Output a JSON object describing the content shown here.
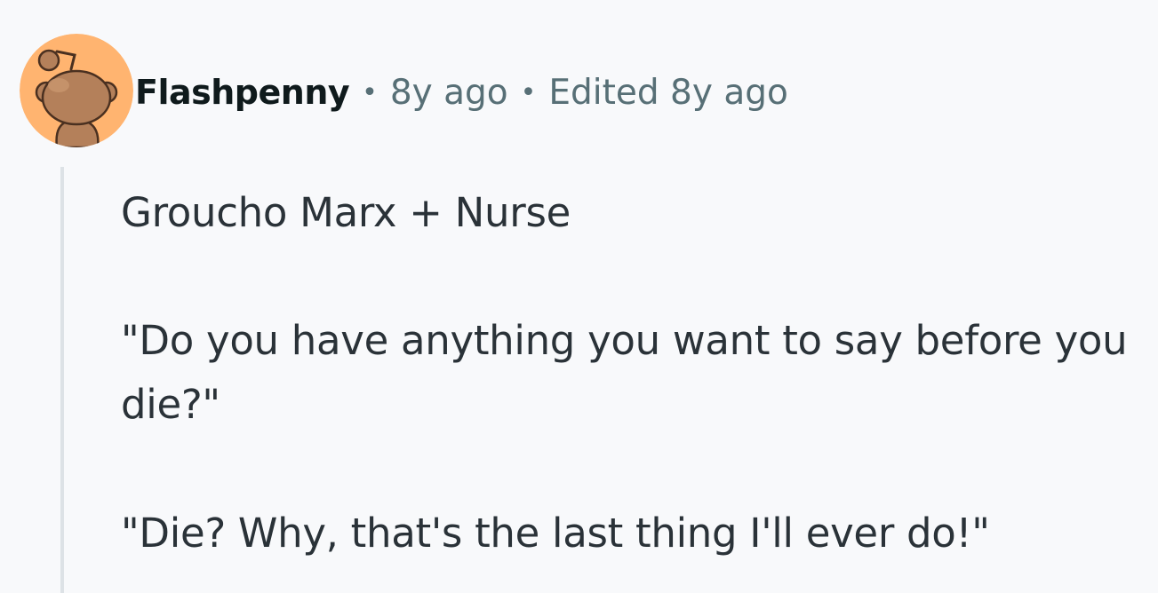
{
  "comment": {
    "author": "Flashpenny",
    "separator": "•",
    "timestamp": "8y ago",
    "edited": "Edited 8y ago",
    "avatar_icon": "reddit-snoo-avatar-icon",
    "avatar_bg_color": "#ffb470",
    "body": [
      "Groucho Marx + Nurse",
      "\"Do you have anything you want to say before you die?\"",
      "\"Die? Why, that's the last thing I'll ever do!\""
    ]
  }
}
